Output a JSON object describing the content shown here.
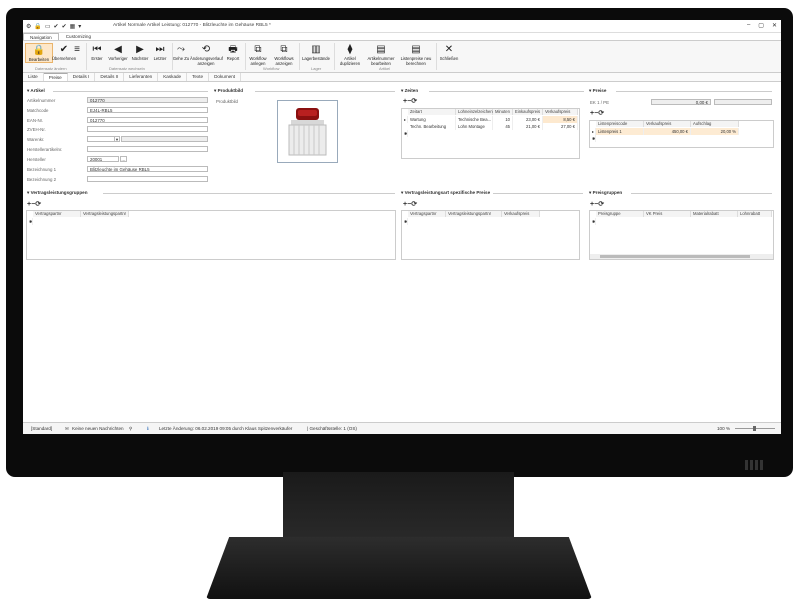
{
  "window": {
    "title": "Artikel Normale Artikel Leistung: 012770 - Blitzleuchte im Gehäuse RBL5 *"
  },
  "ribbon_tabs": [
    "Navigation",
    "Customizing"
  ],
  "ribbon": {
    "buttons": [
      {
        "label": "Bearbeiten",
        "icon": "lock-icon"
      },
      {
        "label": "Übernehmen",
        "icon": "checkmark-icon"
      },
      {
        "label": "Erster",
        "icon": "first-icon"
      },
      {
        "label": "Vorheriger",
        "icon": "previous-icon"
      },
      {
        "label": "Nächster",
        "icon": "next-icon"
      },
      {
        "label": "Letzter",
        "icon": "last-icon"
      },
      {
        "label": "Gehe Zu",
        "icon": "goto-icon"
      },
      {
        "label": "Änderungsverlauf anzeigen",
        "icon": "history-icon"
      },
      {
        "label": "Report",
        "icon": "report-icon"
      },
      {
        "label": "Workflow anlegen",
        "icon": "workflow-icon"
      },
      {
        "label": "Workflows anzeigen",
        "icon": "workflows-icon"
      },
      {
        "label": "Lagerbestände",
        "icon": "stock-icon"
      },
      {
        "label": "Artikel duplizieren",
        "icon": "duplicate-icon"
      },
      {
        "label": "Artikelnummer bearbeiten",
        "icon": "edit-number-icon"
      },
      {
        "label": "Listenpreise neu berechnen",
        "icon": "recalc-icon"
      },
      {
        "label": "Schließen",
        "icon": "close-icon"
      }
    ],
    "groups": [
      "Datensatz ändern",
      "Datensatz wechseln",
      "Workflow",
      "Lager",
      "Artikel"
    ]
  },
  "page_tabs": [
    "Liste",
    "Preise",
    "Details I",
    "Details II",
    "Lieferanten",
    "Kaskade",
    "Texte",
    "Dokument"
  ],
  "artikel": {
    "section": "Artikel",
    "fields": [
      {
        "label": "Artikelnummer",
        "value": "012770"
      },
      {
        "label": "Matchcode",
        "value": "EJ4L-RBL5"
      },
      {
        "label": "EAN-Nr.",
        "value": "012770"
      },
      {
        "label": "ZVEH-Nr.",
        "value": ""
      },
      {
        "label": "Warenkr.",
        "value": ""
      },
      {
        "label": "Herstellerartikelnr.",
        "value": ""
      },
      {
        "label": "Hersteller",
        "value": "20001"
      },
      {
        "label": "Bezeichnung 1",
        "value": "Blitzleuchte im Gehäuse RBL5"
      },
      {
        "label": "Bezeichnung 2",
        "value": ""
      }
    ]
  },
  "produktbild": {
    "section": "Produktbild",
    "label": "Produktbild"
  },
  "zeiten": {
    "section": "Zeiten",
    "headers": [
      "Zeitart",
      "Lohneinzelzeichen",
      "Minuten",
      "Einkaufspreis",
      "Verkaufspreis"
    ],
    "rows": [
      [
        "Wartung",
        "Technische Bea...",
        "10",
        "23,00 €",
        "8,50 €"
      ],
      [
        "Techn. Bearbeitung",
        "Lohn Montage",
        "45",
        "21,00 €",
        "27,00 €"
      ]
    ]
  },
  "preise": {
    "section": "Preise",
    "ek_label": "EK 1 / PE",
    "ek_value": "0,00 €",
    "headers": [
      "Listenpreiscode",
      "Verkaufspreis",
      "Aufschlag"
    ],
    "rows": [
      [
        "Listenpreis 1",
        "450,00 €",
        "20,00 %"
      ]
    ]
  },
  "vertragsleistungsgruppen": {
    "section": "Vertragsleistungsgruppen",
    "headers": [
      "Vertragspartnr",
      "Vertragsleistungspartnr"
    ]
  },
  "vertragsleistungsart": {
    "section": "Vertragsleistungsart spezifische Preise",
    "headers": [
      "Vertragspartnr",
      "Vertragsleistungspartnr",
      "Verkaufspreis"
    ]
  },
  "preisgruppen": {
    "section": "Preisgruppen",
    "headers": [
      "Preisgruppe",
      "VK Preis",
      "Materialrabatt",
      "Lohnrabatt"
    ]
  },
  "status": {
    "view": "[Standard]",
    "messages": "Keine neuen Nachrichten",
    "last_change": "Letzte Änderung: 06.02.2019 09:05 durch Klaus Spitzenverkäufer",
    "office": "| Geschäftsstelle: 1 (OS)",
    "zoom": "100 %"
  }
}
